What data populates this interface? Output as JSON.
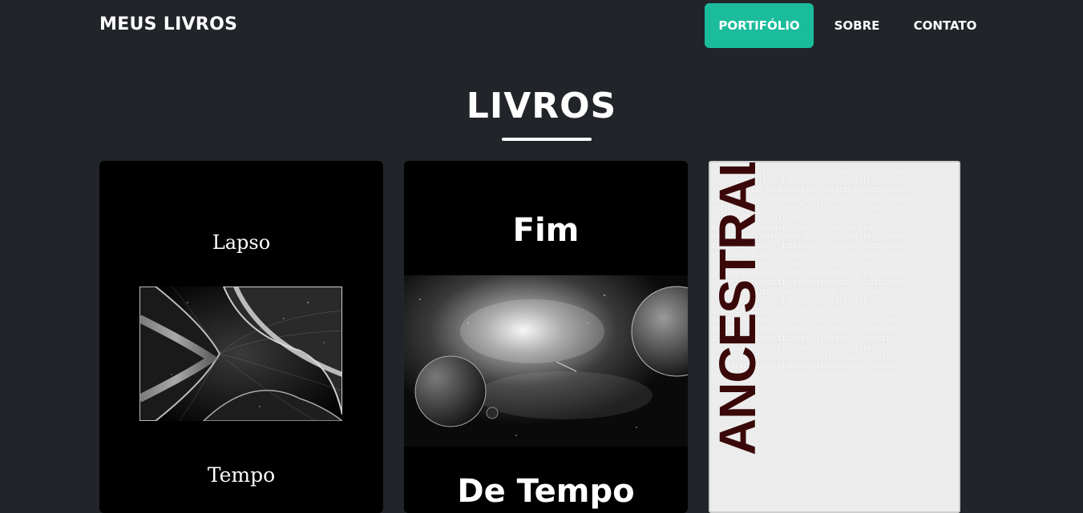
{
  "navbar": {
    "brand": "MEUS LIVROS",
    "links": [
      {
        "label": "PORTIFÓLIO",
        "active": true
      },
      {
        "label": "SOBRE",
        "active": false
      },
      {
        "label": "CONTATO",
        "active": false
      }
    ]
  },
  "section": {
    "title": "LIVROS"
  },
  "books": [
    {
      "cover_top": "Lapso",
      "cover_bottom": "Tempo"
    },
    {
      "cover_top": "Fim",
      "cover_bottom": "De Tempo"
    },
    {
      "cover_title": "ANCESTRAL"
    }
  ],
  "colors": {
    "background": "#212429",
    "accent": "#1abc9c",
    "ancestral_title": "#3a0808"
  }
}
